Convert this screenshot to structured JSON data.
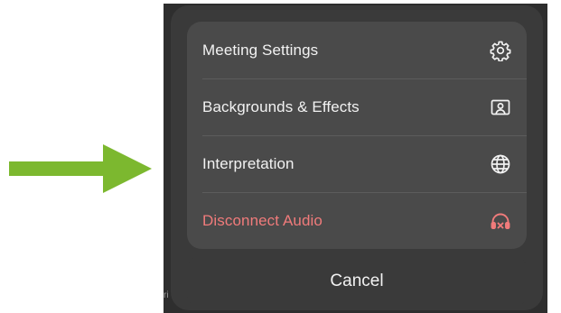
{
  "menu": {
    "items": [
      {
        "label": "Meeting Settings",
        "icon": "gear-icon",
        "danger": false
      },
      {
        "label": "Backgrounds & Effects",
        "icon": "person-portrait-icon",
        "danger": false
      },
      {
        "label": "Interpretation",
        "icon": "globe-icon",
        "danger": false
      },
      {
        "label": "Disconnect Audio",
        "icon": "headphones-disconnect-icon",
        "danger": true
      }
    ]
  },
  "cancel": {
    "label": "Cancel"
  },
  "background": {
    "edge_text": "ri"
  },
  "colors": {
    "arrow": "#7cb82f",
    "danger": "#f07b7b",
    "sheet": "#3a3a3a",
    "card": "#4a4a4a",
    "text": "#f2f2f2"
  }
}
